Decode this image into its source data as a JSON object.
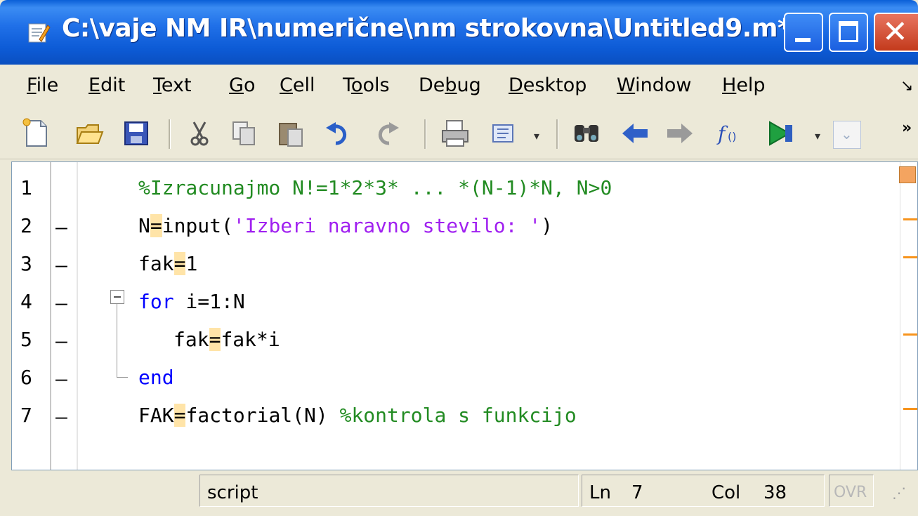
{
  "window": {
    "title": "C:\\vaje NM IR\\numerične\\nm strokovna\\Untitled9.m*"
  },
  "menu": {
    "items": [
      {
        "pre": "",
        "u": "F",
        "post": "ile"
      },
      {
        "pre": "",
        "u": "E",
        "post": "dit"
      },
      {
        "pre": "",
        "u": "T",
        "post": "ext"
      },
      {
        "pre": "",
        "u": "G",
        "post": "o"
      },
      {
        "pre": "",
        "u": "C",
        "post": "ell"
      },
      {
        "pre": "T",
        "u": "o",
        "post": "ols"
      },
      {
        "pre": "De",
        "u": "b",
        "post": "ug"
      },
      {
        "pre": "",
        "u": "D",
        "post": "esktop"
      },
      {
        "pre": "",
        "u": "W",
        "post": "indow"
      },
      {
        "pre": "",
        "u": "H",
        "post": "elp"
      }
    ]
  },
  "toolbar": {
    "icons": [
      "new-file-icon",
      "open-folder-icon",
      "save-icon",
      "cut-icon",
      "copy-icon",
      "paste-icon",
      "undo-icon",
      "redo-icon",
      "print-icon",
      "format-icon",
      "find-icon",
      "back-arrow-icon",
      "forward-arrow-icon",
      "function-icon",
      "run-icon"
    ],
    "more": "»"
  },
  "editor": {
    "lines": [
      {
        "num": "1",
        "dash": ""
      },
      {
        "num": "2",
        "dash": "—"
      },
      {
        "num": "3",
        "dash": "—"
      },
      {
        "num": "4",
        "dash": "—"
      },
      {
        "num": "5",
        "dash": "—"
      },
      {
        "num": "6",
        "dash": "—"
      },
      {
        "num": "7",
        "dash": "—"
      }
    ],
    "code": {
      "l1_comment": "%Izracunajmo N!=1*2*3* ... *(N-1)*N, N>0",
      "l2_var": "N",
      "l2_eq": "=",
      "l2_fn": "input(",
      "l2_str": "'Izberi naravno stevilo: '",
      "l2_close": ")",
      "l3_var": "fak",
      "l3_eq": "=",
      "l3_val": "1",
      "l4_kw": "for",
      "l4_rest": " i=1:N",
      "l5_var": "fak",
      "l5_eq": "=",
      "l5_rest": "fak*i",
      "l6_kw": "end",
      "l7_var": "FAK",
      "l7_eq": "=",
      "l7_rest": "factorial(N) ",
      "l7_comment": "%kontrola s funkcijo"
    }
  },
  "status": {
    "mode": "script",
    "ln_label": "Ln",
    "ln_value": "7",
    "col_label": "Col",
    "col_value": "38",
    "ovr": "OVR"
  },
  "colors": {
    "comment": "#228b22",
    "keyword": "#0000ff",
    "string": "#a020f0"
  }
}
